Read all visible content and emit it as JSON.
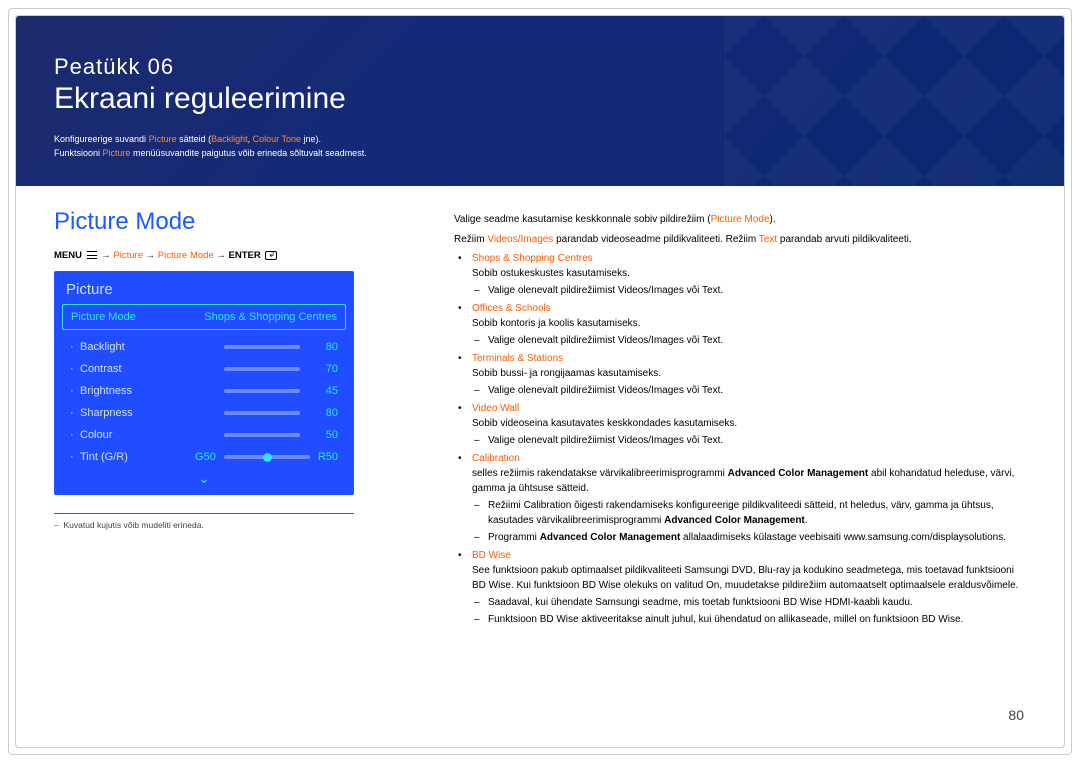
{
  "chapter": {
    "pre": "Peatükk  06",
    "title": "Ekraani reguleerimine"
  },
  "banner_lines": {
    "l1a": "Konfigureerige suvandi ",
    "l1b": "Picture",
    "l1c": " sätteid (",
    "l1d": "Backlight",
    "l1e": ", ",
    "l1f": "Colour Tone",
    "l1g": " jne).",
    "l2a": "Funktsiooni ",
    "l2b": "Picture",
    "l2c": " menüüsuvandite paigutus võib erineda sõltuvalt seadmest."
  },
  "section_title": "Picture Mode",
  "menu_path": {
    "menu": "MENU",
    "arrow": " → ",
    "p1": "Picture",
    "p2": "Picture Mode",
    "enter": "ENTER"
  },
  "osd": {
    "panel_title": "Picture",
    "mode_label": "Picture Mode",
    "mode_value": "Shops & Shopping Centres",
    "rows": [
      {
        "label": "Backlight",
        "value": 80
      },
      {
        "label": "Contrast",
        "value": 70
      },
      {
        "label": "Brightness",
        "value": 45
      },
      {
        "label": "Sharpness",
        "value": 80
      },
      {
        "label": "Colour",
        "value": 50
      }
    ],
    "tint": {
      "label": "Tint (G/R)",
      "g": "G50",
      "r": "R50",
      "pos": 50
    }
  },
  "note_dash": "–",
  "note_text": "Kuvatud kujutis võib mudeliti erineda.",
  "intro1a": "Valige seadme kasutamise keskkonnale sobiv pildirežiim (",
  "intro1b": "Picture Mode",
  "intro1c": ").",
  "intro2a": "Režiim ",
  "intro2b": "Videos/Images",
  "intro2c": " parandab videoseadme pildikvaliteeti. Režiim ",
  "intro2d": "Text",
  "intro2e": " parandab arvuti pildikvaliteeti.",
  "modes": {
    "shops": {
      "head": "Shops & Shopping Centres",
      "desc": "Sobib ostukeskustes kasutamiseks.",
      "sub_a": "Valige olenevalt pildirežiimist ",
      "sub_b": "Videos/Images",
      "sub_c": " või ",
      "sub_d": "Text",
      "sub_e": "."
    },
    "offices": {
      "head": "Offices & Schools",
      "desc": "Sobib kontoris ja koolis kasutamiseks.",
      "sub_a": "Valige olenevalt pildirežiimist ",
      "sub_b": "Videos/Images",
      "sub_c": " või ",
      "sub_d": "Text",
      "sub_e": "."
    },
    "terminals": {
      "head": "Terminals & Stations",
      "desc": "Sobib bussi- ja rongijaamas kasutamiseks.",
      "sub_a": "Valige olenevalt pildirežiimist ",
      "sub_b": "Videos/Images",
      "sub_c": " või ",
      "sub_d": "Text",
      "sub_e": "."
    },
    "videowall": {
      "head": "Video Wall",
      "desc": "Sobib videoseina kasutavates keskkondades kasutamiseks.",
      "sub_a": "Valige olenevalt pildirežiimist ",
      "sub_b": "Videos/Images",
      "sub_c": " või ",
      "sub_d": "Text",
      "sub_e": "."
    },
    "calibration": {
      "head": "Calibration",
      "desc_a": "selles režiimis rakendatakse värvikalibreerimisprogrammi ",
      "desc_b": "Advanced Color Management",
      "desc_c": " abil kohandatud heleduse, värvi, gamma ja ühtsuse sätteid.",
      "sub1_a": "Režiimi ",
      "sub1_b": "Calibration",
      "sub1_c": " õigesti rakendamiseks konfigureerige pildikvaliteedi sätteid, nt heledus, värv, gamma ja ühtsus, kasutades värvikalibreerimisprogrammi ",
      "sub1_d": "Advanced Color Management",
      "sub1_e": ".",
      "sub2_a": "Programmi ",
      "sub2_b": "Advanced Color Management",
      "sub2_c": " allalaadimiseks külastage veebisaiti www.samsung.com/displaysolutions."
    },
    "bdwise": {
      "head": "BD Wise",
      "desc_a": "See funktsioon pakub optimaalset pildikvaliteeti Samsungi DVD, Blu-ray ja kodukino seadmetega, mis toetavad funktsiooni ",
      "desc_b": "BD Wise",
      "desc_c": ". Kui funktsioon ",
      "desc_d": "BD Wise",
      "desc_e": " olekuks on valitud ",
      "desc_f": "On",
      "desc_g": ", muudetakse pildirežiim automaatselt optimaalsele eraldusvõimele.",
      "sub1_a": "Saadaval, kui ühendate Samsungi seadme, mis toetab funktsiooni ",
      "sub1_b": "BD Wise",
      "sub1_c": " HDMI-kaabli kaudu.",
      "sub2_a": "Funktsioon ",
      "sub2_b": "BD Wise",
      "sub2_c": " aktiveeritakse ainult juhul, kui ühendatud on allikaseade, millel on funktsioon ",
      "sub2_d": "BD Wise",
      "sub2_e": "."
    }
  },
  "page_number": "80"
}
